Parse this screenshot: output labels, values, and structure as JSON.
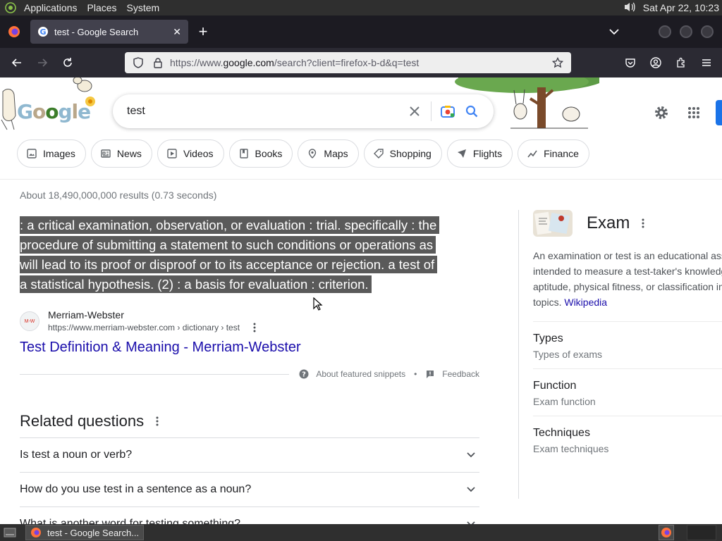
{
  "system_panel": {
    "menus": [
      "Applications",
      "Places",
      "System"
    ],
    "clock": "Sat Apr 22, 10:23",
    "icons": [
      "distro-logo-icon",
      "volume-icon"
    ]
  },
  "browser": {
    "tab": {
      "title": "test - Google Search",
      "close_label": "✕"
    },
    "new_tab_label": "+",
    "url_prefix": "https://www.",
    "url_domain": "google.com",
    "url_rest": "/search?client=firefox-b-d&q=test"
  },
  "google": {
    "search_query": "test",
    "chips": [
      {
        "label": "Images",
        "icon": "image-icon"
      },
      {
        "label": "News",
        "icon": "news-icon"
      },
      {
        "label": "Videos",
        "icon": "video-icon"
      },
      {
        "label": "Books",
        "icon": "book-icon"
      },
      {
        "label": "Maps",
        "icon": "map-pin-icon"
      },
      {
        "label": "Shopping",
        "icon": "tag-icon"
      },
      {
        "label": "Flights",
        "icon": "plane-icon"
      },
      {
        "label": "Finance",
        "icon": "finance-icon"
      }
    ],
    "result_stats": "About 18,490,000,000 results (0.73 seconds)",
    "featured_snippet": {
      "lines": [
        ": a critical examination, observation, or evaluation : trial. specifically : the",
        "procedure of submitting a statement to such conditions or operations as",
        "will lead to its proof or disproof or to its acceptance or rejection. a test of",
        "a statistical hypothesis. (2) : a basis for evaluation : criterion."
      ],
      "source_name": "Merriam-Webster",
      "source_favicon_text": "M-W",
      "source_url": "https://www.merriam-webster.com › dictionary › test",
      "result_title": "Test Definition & Meaning - Merriam-Webster",
      "about_label": "About featured snippets",
      "separator": "•",
      "feedback_label": "Feedback"
    },
    "related_questions": {
      "heading": "Related questions",
      "items": [
        "Is test a noun or verb?",
        "How do you use test in a sentence as a noun?",
        "What is another word for testing something?"
      ]
    },
    "knowledge_panel": {
      "title": "Exam",
      "description_lines": [
        "An examination or test is an educational assessment",
        "intended to measure a test-taker's knowledge, skill,",
        "aptitude, physical fitness, or classification in many other",
        "topics. "
      ],
      "wiki_link": "Wikipedia",
      "rows": [
        {
          "heading": "Types",
          "sub": "Types of exams"
        },
        {
          "heading": "Function",
          "sub": "Exam function"
        },
        {
          "heading": "Techniques",
          "sub": "Exam techniques"
        }
      ]
    }
  },
  "taskbar": {
    "window_title": "test - Google Search..."
  },
  "colors": {
    "link_blue": "#1a0dab",
    "google_blue": "#4285f4",
    "snippet_highlight": "#5a5a5a",
    "firefox_dark": "#1c1b22"
  }
}
